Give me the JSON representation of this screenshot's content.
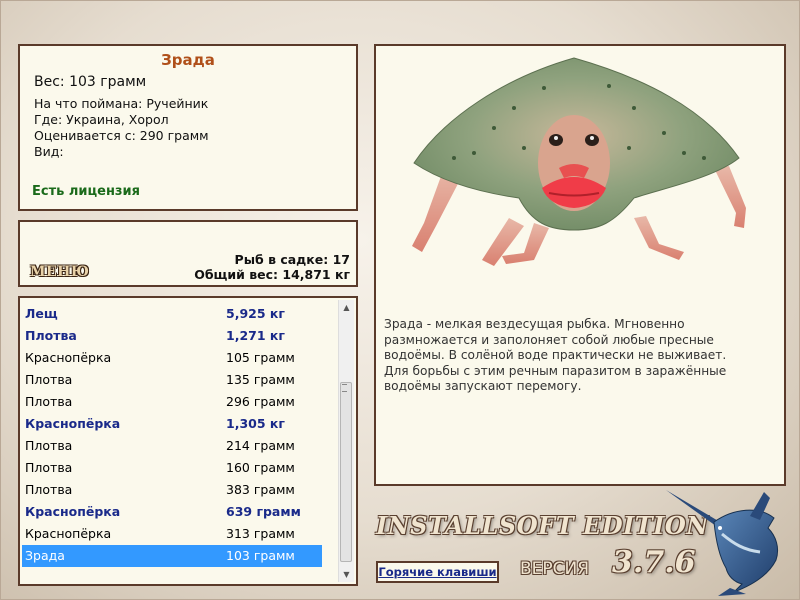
{
  "catch": {
    "title": "Зрада",
    "weight": "Вес: 103 грамм",
    "info": [
      "На что поймана: Ручейник",
      "Где: Украина, Хорол",
      "Оценивается с: 290 грамм",
      "Вид:"
    ],
    "license": "Есть лицензия"
  },
  "stats": {
    "menu_label": "МЕНЮ",
    "fish_count": "Рыб в садке: 17",
    "total_weight": "Общий вес: 14,871 кг"
  },
  "fish_list": [
    {
      "name": "Лещ",
      "weight": "5,925 кг",
      "bold": true
    },
    {
      "name": "Плотва",
      "weight": "1,271 кг",
      "bold": true
    },
    {
      "name": "Краснопёрка",
      "weight": "105 грамм",
      "bold": false
    },
    {
      "name": "Плотва",
      "weight": "135 грамм",
      "bold": false
    },
    {
      "name": "Плотва",
      "weight": "296 грамм",
      "bold": false
    },
    {
      "name": "Краснопёрка",
      "weight": "1,305 кг",
      "bold": true
    },
    {
      "name": "Плотва",
      "weight": "214 грамм",
      "bold": false
    },
    {
      "name": "Плотва",
      "weight": "160 грамм",
      "bold": false
    },
    {
      "name": "Плотва",
      "weight": "383 грамм",
      "bold": false
    },
    {
      "name": "Краснопёрка",
      "weight": "639 грамм",
      "bold": true
    },
    {
      "name": "Краснопёрка",
      "weight": "313 грамм",
      "bold": false
    },
    {
      "name": "Зрада",
      "weight": "103 грамм",
      "bold": false,
      "selected": true
    }
  ],
  "description": "Зрада - мелкая вездесущая рыбка. Мгновенно размножается и заполоняет собой любые пресные водоёмы. В солёной воде практически не выживает. Для борьбы с этим речным паразитом в заражённые водоёмы запускают перемогу.",
  "branding": {
    "edition": "INSTALLSOFT EDITION",
    "version_label": "ВЕРСИЯ",
    "version_number": "3.7.6"
  },
  "hotkeys_label": "Горячие клавиши",
  "colors": {
    "panel_bg": "#fbf9ec",
    "panel_border": "#5a3a2a",
    "title_orange": "#b0501a",
    "license_green": "#1a6a1a",
    "bold_blue": "#1a2a8a",
    "selection_blue": "#3399ff"
  }
}
